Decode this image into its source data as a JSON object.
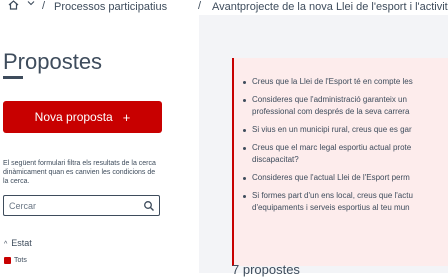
{
  "breadcrumb": {
    "items": [
      {
        "label": "Processos participatius"
      },
      {
        "label": "Avantprojecte de la nova Llei de l'esport i l'activitat física"
      }
    ],
    "separator": "/",
    "home_icon": "home-icon",
    "dropdown_icon": "chevron-down-icon"
  },
  "sidebar": {
    "title": "Propostes",
    "new_button": {
      "label": "Nova proposta",
      "icon": "+"
    },
    "filter_help": "El següent formulari filtra els resultats de la cerca dinàmicament quan es canvien les condicions de la cerca.",
    "search": {
      "placeholder": "Cercar",
      "icon": "search-icon"
    },
    "facet": {
      "title": "Estat",
      "caret": "^",
      "option_label": "Tots"
    }
  },
  "main": {
    "questions": [
      "Creus que la Llei de l'Esport té en compte les",
      "Consideres que l'administració garanteix un",
      "professional com després de la seva carrera",
      "Si vius en un municipi rural, creus que es gar",
      "Creus que el marc legal esportiu actual prote",
      "discapacitat?",
      "Consideres que l'actual Llei de l'Esport perm",
      "Si formes part d'un ens local, creus que l'actu",
      "d'equipaments i serveis esportius al teu mun"
    ],
    "proposals_count": "7 propostes"
  },
  "colors": {
    "accent": "#c80000",
    "text": "#3e4c5c",
    "callout_bg": "#fdecec",
    "main_bg": "#f3f4f7"
  }
}
